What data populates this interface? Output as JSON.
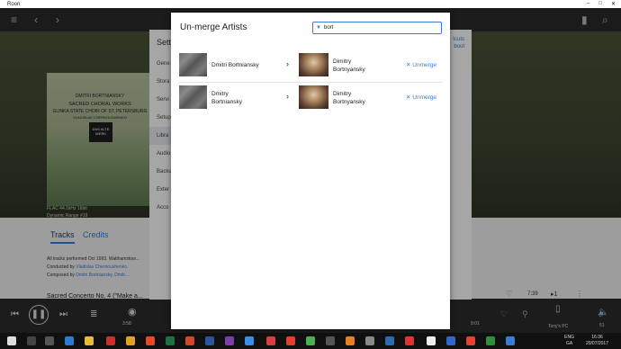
{
  "window": {
    "title": "Roon"
  },
  "album": {
    "line1": "DMITRI BORTNIANSKY",
    "line2": "SACRED CHORAL WORKS",
    "line3": "GLINKA STATE CHOIR OF ST. PETERSBURG",
    "line4": "VLADISLAV CHERNOUSHENKO",
    "logo": "DAS ALTE WERK",
    "format": "FLAC 44.1kHz 16bit",
    "dynamic_range": "Dynamic Range  #19"
  },
  "tabs": {
    "tracks": "Tracks",
    "credits": "Credits"
  },
  "info": {
    "line1": "All tracks performed Oct 1993. Walthamstow...",
    "conducted_prefix": "Conducted by ",
    "conducted_link": "Vladislav Chernoushenko.",
    "composed_prefix": "Composed by ",
    "composed_link": "Dmitri Bortniansky, Dmitr..."
  },
  "track": {
    "title": "Sacred Concerto No. 4 (\"Make a...",
    "duration": "7:39"
  },
  "player": {
    "elapsed": "3:58",
    "remaining": "9:01",
    "zone": "Tony's PC",
    "volume": "51"
  },
  "settings": {
    "title": "Setti",
    "right_links": [
      "tcuts",
      "bout"
    ],
    "nav": [
      "Gene",
      "Stora",
      "Servi",
      "Setup",
      "Libra",
      "Audio",
      "Backu",
      "Exter",
      "Acco"
    ],
    "selected_index": 4
  },
  "modal": {
    "title": "Un-merge Artists",
    "filter_value": "bort",
    "unmerge_label": "Unmerge",
    "rows": [
      {
        "left_name": "Dmitri Bortniansky",
        "right_name": "Dimitry Bortnyansky"
      },
      {
        "left_name": "Dmitry Bortniansky",
        "right_name": "Dimitry Bortnyansky"
      }
    ]
  },
  "taskbar": {
    "time": "16:36",
    "date": "20/07/2017",
    "lang": "ENG",
    "region": "GA"
  }
}
